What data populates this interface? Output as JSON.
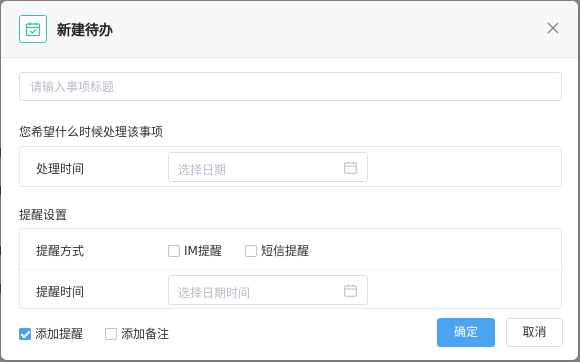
{
  "dialog": {
    "title": "新建待办",
    "icons": {
      "header": "calendar-check-icon",
      "close": "close-icon",
      "date": "calendar-icon"
    }
  },
  "title_input": {
    "placeholder": "请输入事项标题",
    "value": ""
  },
  "when_section": {
    "label": "您希望什么时候处理该事项",
    "time_label": "处理时间",
    "date_placeholder": "选择日期"
  },
  "reminder_section": {
    "label": "提醒设置",
    "method_label": "提醒方式",
    "options": [
      {
        "label": "IM提醒",
        "checked": false
      },
      {
        "label": "短信提醒",
        "checked": false
      }
    ],
    "time_label": "提醒时间",
    "datetime_placeholder": "选择日期时间"
  },
  "footer": {
    "add_reminder": {
      "label": "添加提醒",
      "checked": true
    },
    "add_note": {
      "label": "添加备注",
      "checked": false
    },
    "confirm_label": "确定",
    "cancel_label": "取消"
  },
  "colors": {
    "primary": "#4aa4f2",
    "accent_icon": "#39c0a8"
  }
}
